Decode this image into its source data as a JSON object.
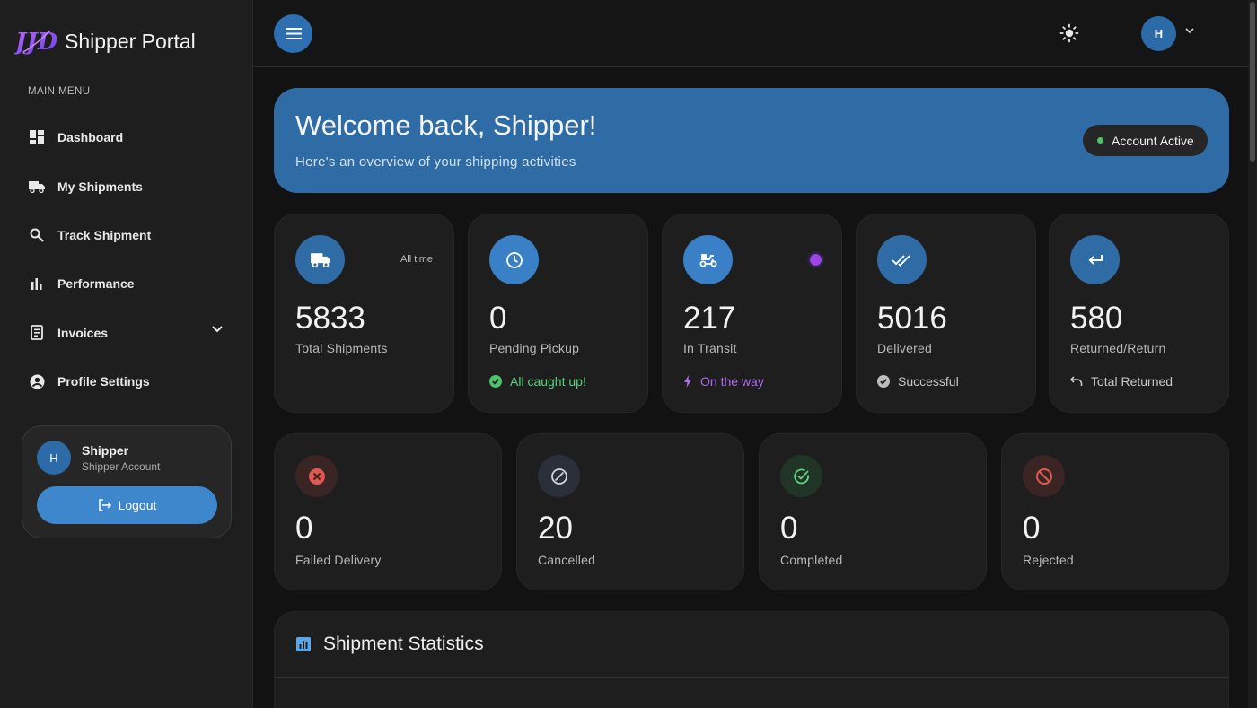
{
  "brand": {
    "title": "Shipper Portal",
    "logo_text": "JJD"
  },
  "sidebar": {
    "caption": "MAIN MENU",
    "items": [
      {
        "label": "Dashboard",
        "icon": "dashboard-icon"
      },
      {
        "label": "My Shipments",
        "icon": "truck-icon"
      },
      {
        "label": "Track Shipment",
        "icon": "search-icon"
      },
      {
        "label": "Performance",
        "icon": "bar-chart-icon"
      },
      {
        "label": "Invoices",
        "icon": "invoice-icon"
      },
      {
        "label": "Profile Settings",
        "icon": "account-circle-icon"
      }
    ],
    "user": {
      "avatar": "H",
      "name": "Shipper",
      "role": "Shipper Account",
      "logout_label": "Logout"
    }
  },
  "topbar": {
    "avatar": "H"
  },
  "banner": {
    "title": "Welcome back, Shipper!",
    "subtitle": "Here's an overview of your shipping activities",
    "badge": "Account Active"
  },
  "stats_row1": [
    {
      "value": "5833",
      "label": "Total Shipments",
      "tag": "All time",
      "icon": "truck-icon"
    },
    {
      "value": "0",
      "label": "Pending Pickup",
      "footer": "All caught up!",
      "icon": "clock-icon"
    },
    {
      "value": "217",
      "label": "In Transit",
      "footer": "On the way",
      "icon": "scooter-icon"
    },
    {
      "value": "5016",
      "label": "Delivered",
      "footer": "Successful",
      "icon": "double-check-icon"
    },
    {
      "value": "580",
      "label": "Returned/Return",
      "footer": "Total Returned",
      "icon": "return-arrow-icon"
    }
  ],
  "stats_row2": [
    {
      "value": "0",
      "label": "Failed Delivery",
      "icon": "x-circle-icon"
    },
    {
      "value": "20",
      "label": "Cancelled",
      "icon": "slash-circle-icon"
    },
    {
      "value": "0",
      "label": "Completed",
      "icon": "check-circle-icon"
    },
    {
      "value": "0",
      "label": "Rejected",
      "icon": "block-icon"
    }
  ],
  "statistics": {
    "title": "Shipment Statistics"
  },
  "colors": {
    "accent": "#3f87cc",
    "banner": "#2f6ca6",
    "success": "#4cc26a",
    "transit": "#b06cf0",
    "danger": "#e0594f"
  }
}
